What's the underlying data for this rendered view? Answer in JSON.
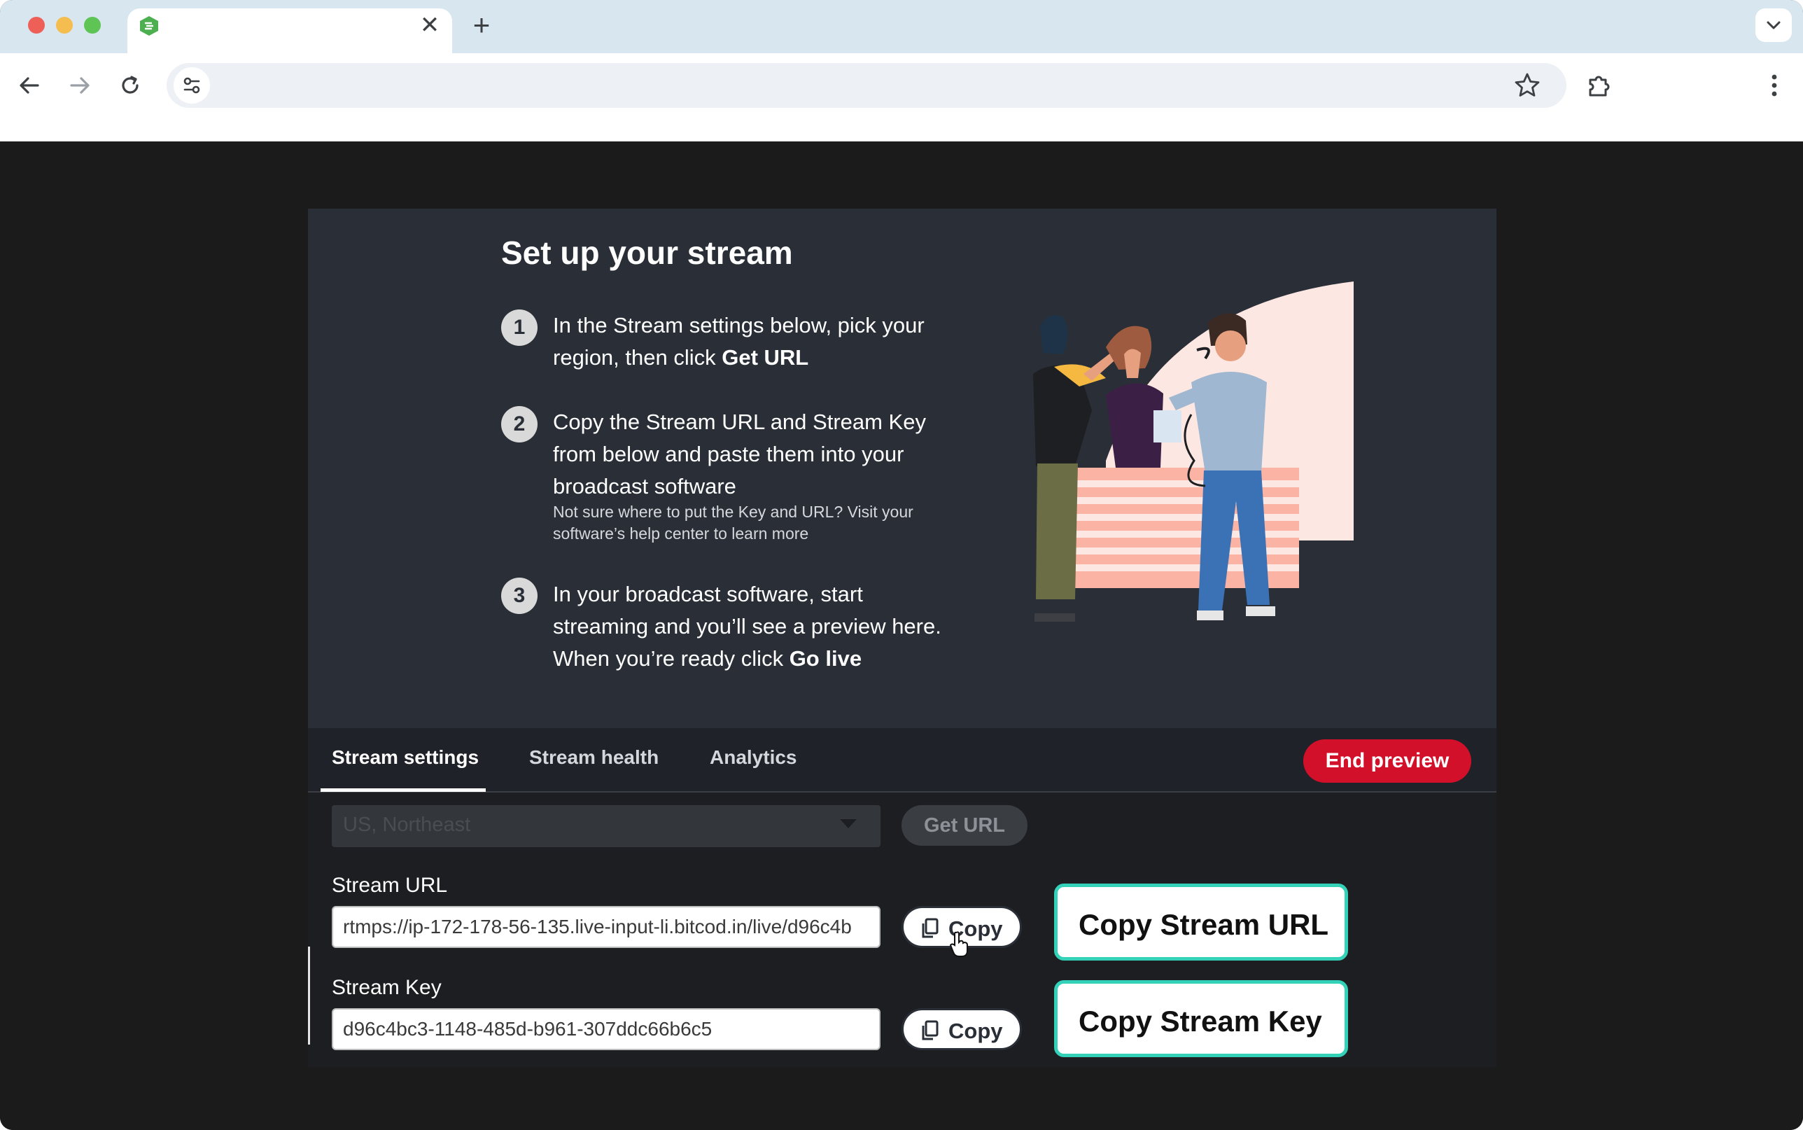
{
  "browser": {
    "tab": {
      "title": "",
      "favicon": "green-hexagon-icon",
      "close_glyph": "✕"
    },
    "new_tab_glyph": "+",
    "address": {
      "url": ""
    },
    "icons": {
      "back": "arrow-left-icon",
      "forward": "arrow-right-icon",
      "reload": "reload-icon",
      "site_info": "tune-icon",
      "bookmark": "star-icon",
      "extensions": "puzzle-icon",
      "menu": "kebab-icon",
      "tab_list": "chevron-down-icon"
    },
    "colors": {
      "tabbar": "#d7e6ef",
      "omnibox": "#edf1f5"
    }
  },
  "setup": {
    "title": "Set up your stream",
    "steps": [
      {
        "number": "1",
        "text": "In the Stream settings below, pick your region, then click ",
        "bold": "Get URL"
      },
      {
        "number": "2",
        "text": "Copy the Stream URL and Stream Key from below and paste them into your broadcast software",
        "sub": "Not sure where to put the Key and URL? Visit your software’s help center to learn more"
      },
      {
        "number": "3",
        "text": "In your broadcast software, start streaming and you’ll see a preview here. When you’re ready click ",
        "bold": "Go live"
      }
    ]
  },
  "tabs": [
    {
      "label": "Stream settings",
      "active": true
    },
    {
      "label": "Stream health",
      "active": false
    },
    {
      "label": "Analytics",
      "active": false
    }
  ],
  "end_preview_label": "End preview",
  "region": {
    "value": "US, Northeast"
  },
  "get_url_label": "Get URL",
  "stream_url": {
    "label": "Stream URL",
    "value": "rtmps://ip-172-178-56-135.live-input-li.bitcod.in/live/d96c4b"
  },
  "stream_key": {
    "label": "Stream Key",
    "value": "d96c4bc3-1148-485d-b961-307ddc66b6c5"
  },
  "copy_label": "Copy",
  "callouts": {
    "url": "Copy Stream URL",
    "key": "Copy Stream Key"
  },
  "colors": {
    "accent_red": "#d3102a",
    "callout_border": "#33d1b8",
    "panel": "#2a2f37"
  }
}
